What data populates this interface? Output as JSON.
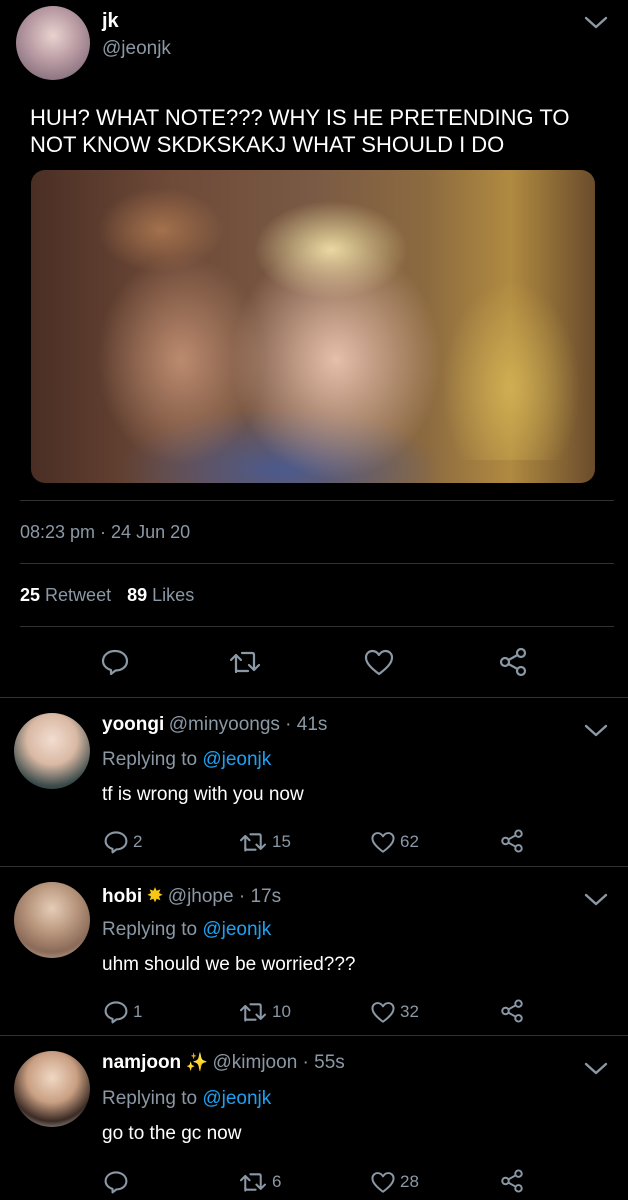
{
  "tweet": {
    "display_name": "jk",
    "handle": "@jeonjk",
    "text_line1": "HUH? WHAT NOTE??? WHY IS HE PRETENDING TO",
    "text_line2": "NOT KNOW SKDKSKAKJ WHAT SHOULD I DO",
    "timestamp": "08:23 pm · 24 Jun 20",
    "retweet_count": "25",
    "retweet_label": "Retweet",
    "likes_count": "89",
    "likes_label": "Likes"
  },
  "replies": [
    {
      "name": "yoongi",
      "badge": "",
      "meta": "@minyoongs · 41s",
      "replying_prefix": "Replying to",
      "replying_handle": "@jeonjk",
      "text": "tf is wrong with you now",
      "reply_count": "2",
      "retweet_count": "15",
      "like_count": "62"
    },
    {
      "name": "hobi",
      "badge": "✸",
      "meta": "@jhope · 17s",
      "replying_prefix": "Replying to",
      "replying_handle": "@jeonjk",
      "text": "uhm should we be worried???",
      "reply_count": "1",
      "retweet_count": "10",
      "like_count": "32"
    },
    {
      "name": "namjoon",
      "badge": "✨",
      "meta": "@kimjoon · 55s",
      "replying_prefix": "Replying to",
      "replying_handle": "@jeonjk",
      "text": "go to the gc now",
      "reply_count": "",
      "retweet_count": "6",
      "like_count": "28"
    }
  ],
  "colors": {
    "background": "#000000",
    "muted": "#8b98a5",
    "link": "#1da1f2",
    "divider": "#2f3336",
    "badge_yellow": "#f5c518"
  }
}
